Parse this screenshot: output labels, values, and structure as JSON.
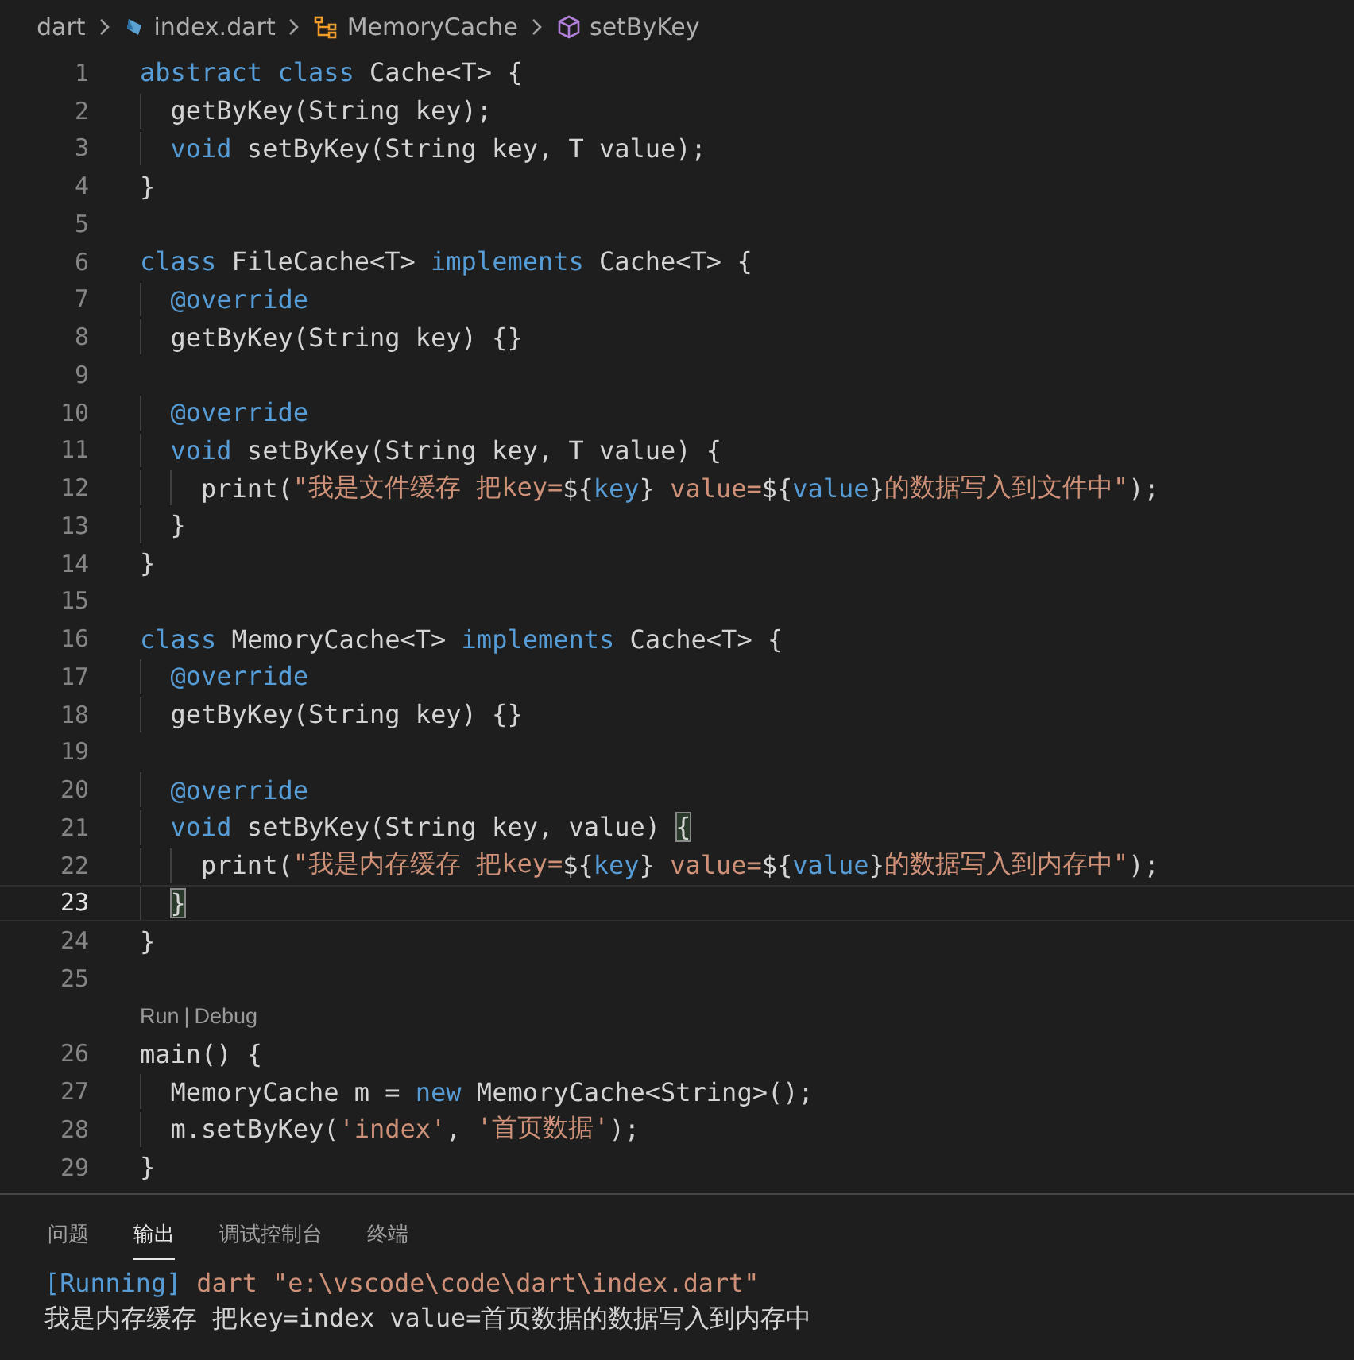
{
  "breadcrumbs": [
    {
      "kind": "folder",
      "label": "dart"
    },
    {
      "kind": "dart-file",
      "label": "index.dart"
    },
    {
      "kind": "class",
      "label": "MemoryCache"
    },
    {
      "kind": "method",
      "label": "setByKey"
    }
  ],
  "editor": {
    "lines": [
      {
        "kind": "code",
        "number": "1",
        "current": false,
        "tokens": [
          {
            "t": "abstract class",
            "kind": "kw"
          },
          {
            "t": " Cache<T> {",
            "kind": "plain"
          }
        ]
      },
      {
        "kind": "code",
        "number": "2",
        "current": false,
        "tokens": [
          {
            "t": "  getByKey(String key);",
            "kind": "plain"
          }
        ]
      },
      {
        "kind": "code",
        "number": "3",
        "current": false,
        "tokens": [
          {
            "t": "  void",
            "kind": "kw"
          },
          {
            "t": " setByKey(String key, T value);",
            "kind": "plain"
          }
        ]
      },
      {
        "kind": "code",
        "number": "4",
        "current": false,
        "tokens": [
          {
            "t": "}",
            "kind": "plain"
          }
        ]
      },
      {
        "kind": "code",
        "number": "5",
        "current": false
      },
      {
        "kind": "code",
        "number": "6",
        "current": false,
        "tokens": [
          {
            "t": "class",
            "kind": "kw"
          },
          {
            "t": " FileCache<T> ",
            "kind": "plain"
          },
          {
            "t": "implements",
            "kind": "kw"
          },
          {
            "t": " Cache<T> {",
            "kind": "plain"
          }
        ]
      },
      {
        "kind": "code",
        "number": "7",
        "current": false,
        "tokens": [
          {
            "t": "  @override",
            "kind": "kw"
          }
        ]
      },
      {
        "kind": "code",
        "number": "8",
        "current": false,
        "tokens": [
          {
            "t": "  getByKey(String key) {}",
            "kind": "plain"
          }
        ]
      },
      {
        "kind": "code",
        "number": "9",
        "current": false
      },
      {
        "kind": "code",
        "number": "10",
        "current": false,
        "tokens": [
          {
            "t": "  @override",
            "kind": "kw"
          }
        ]
      },
      {
        "kind": "code",
        "number": "11",
        "current": false,
        "tokens": [
          {
            "t": "  void",
            "kind": "kw"
          },
          {
            "t": " setByKey(String key, T value) {",
            "kind": "plain"
          }
        ]
      },
      {
        "kind": "code",
        "number": "12",
        "current": false,
        "tokens": [
          {
            "t": "    print(",
            "kind": "plain"
          },
          {
            "t": "\"我是文件缓存 把key=",
            "kind": "str"
          },
          {
            "t": "${",
            "kind": "plain"
          },
          {
            "t": "key",
            "kind": "kw"
          },
          {
            "t": "}",
            "kind": "plain"
          },
          {
            "t": " value=",
            "kind": "str"
          },
          {
            "t": "${",
            "kind": "plain"
          },
          {
            "t": "value",
            "kind": "kw"
          },
          {
            "t": "}",
            "kind": "plain"
          },
          {
            "t": "的数据写入到文件中\"",
            "kind": "str"
          },
          {
            "t": ");",
            "kind": "plain"
          }
        ]
      },
      {
        "kind": "code",
        "number": "13",
        "current": false,
        "tokens": [
          {
            "t": "  }",
            "kind": "plain"
          }
        ]
      },
      {
        "kind": "code",
        "number": "14",
        "current": false,
        "tokens": [
          {
            "t": "}",
            "kind": "plain"
          }
        ]
      },
      {
        "kind": "code",
        "number": "15",
        "current": false
      },
      {
        "kind": "code",
        "number": "16",
        "current": false,
        "tokens": [
          {
            "t": "class",
            "kind": "kw"
          },
          {
            "t": " MemoryCache<T> ",
            "kind": "plain"
          },
          {
            "t": "implements",
            "kind": "kw"
          },
          {
            "t": " Cache<T> {",
            "kind": "plain"
          }
        ]
      },
      {
        "kind": "code",
        "number": "17",
        "current": false,
        "tokens": [
          {
            "t": "  @override",
            "kind": "kw"
          }
        ]
      },
      {
        "kind": "code",
        "number": "18",
        "current": false,
        "tokens": [
          {
            "t": "  getByKey(String key) {}",
            "kind": "plain"
          }
        ]
      },
      {
        "kind": "code",
        "number": "19",
        "current": false
      },
      {
        "kind": "code",
        "number": "20",
        "current": false,
        "tokens": [
          {
            "t": "  @override",
            "kind": "kw"
          }
        ]
      },
      {
        "kind": "code",
        "number": "21",
        "current": false,
        "tokens": [
          {
            "t": "  void",
            "kind": "kw"
          },
          {
            "t": " setByKey(String key, value) ",
            "kind": "plain"
          },
          {
            "t": "{",
            "kind": "plain",
            "matched": true
          }
        ]
      },
      {
        "kind": "code",
        "number": "22",
        "current": false,
        "tokens": [
          {
            "t": "    print(",
            "kind": "plain"
          },
          {
            "t": "\"我是内存缓存 把key=",
            "kind": "str"
          },
          {
            "t": "${",
            "kind": "plain"
          },
          {
            "t": "key",
            "kind": "kw"
          },
          {
            "t": "}",
            "kind": "plain"
          },
          {
            "t": " value=",
            "kind": "str"
          },
          {
            "t": "${",
            "kind": "plain"
          },
          {
            "t": "value",
            "kind": "kw"
          },
          {
            "t": "}",
            "kind": "plain"
          },
          {
            "t": "的数据写入到内存中\"",
            "kind": "str"
          },
          {
            "t": ");",
            "kind": "plain"
          }
        ]
      },
      {
        "kind": "code",
        "number": "23",
        "current": true,
        "tokens": [
          {
            "t": "  }",
            "kind": "plain",
            "matched": true
          }
        ]
      },
      {
        "kind": "code",
        "number": "24",
        "current": false,
        "tokens": [
          {
            "t": "}",
            "kind": "plain"
          }
        ]
      },
      {
        "kind": "code",
        "number": "25",
        "current": false
      },
      {
        "kind": "codelens",
        "links": [
          "Run",
          "Debug"
        ],
        "separator": "|"
      },
      {
        "kind": "code",
        "number": "26",
        "current": false,
        "tokens": [
          {
            "t": "main() {",
            "kind": "plain"
          }
        ]
      },
      {
        "kind": "code",
        "number": "27",
        "current": false,
        "tokens": [
          {
            "t": "  MemoryCache m = ",
            "kind": "plain"
          },
          {
            "t": "new",
            "kind": "kw"
          },
          {
            "t": " MemoryCache<String>();",
            "kind": "plain"
          }
        ]
      },
      {
        "kind": "code",
        "number": "28",
        "current": false,
        "tokens": [
          {
            "t": "  m.setByKey(",
            "kind": "plain"
          },
          {
            "t": "'index'",
            "kind": "str"
          },
          {
            "t": ", ",
            "kind": "plain"
          },
          {
            "t": "'首页数据'",
            "kind": "str"
          },
          {
            "t": ");",
            "kind": "plain"
          }
        ]
      },
      {
        "kind": "code",
        "number": "29",
        "current": false,
        "tokens": [
          {
            "t": "}",
            "kind": "plain"
          }
        ]
      }
    ]
  },
  "panel": {
    "tabs": [
      {
        "label": "问题",
        "selected": false
      },
      {
        "label": "输出",
        "selected": true
      },
      {
        "label": "调试控制台",
        "selected": false
      },
      {
        "label": "终端",
        "selected": false
      }
    ],
    "output": [
      [
        {
          "t": "[Running]",
          "kind": "kw"
        },
        {
          "t": " dart \"e:\\vscode\\code\\dart\\index.dart\"",
          "kind": "str"
        }
      ],
      [
        {
          "t": "我是内存缓存 把key=index value=首页数据的数据写入到内存中",
          "kind": "plain"
        }
      ]
    ]
  }
}
